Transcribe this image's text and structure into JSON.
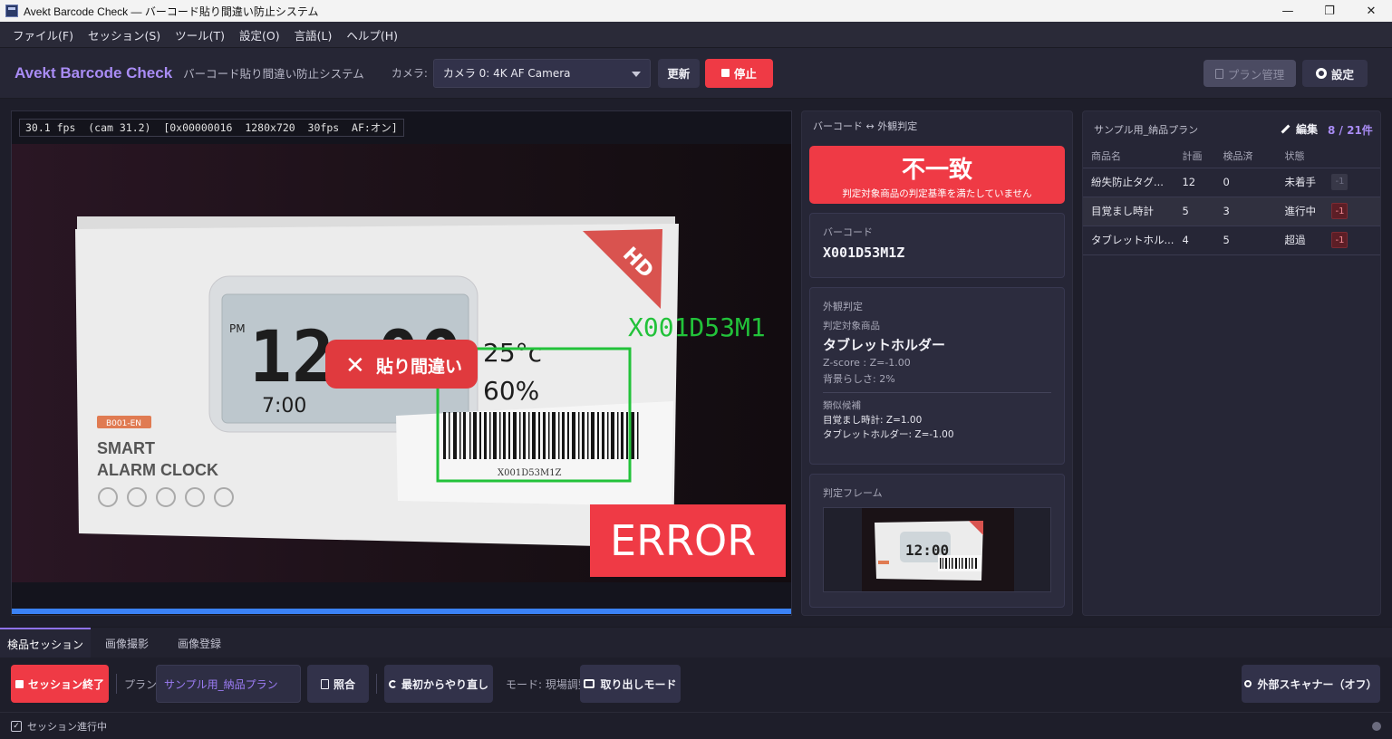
{
  "window": {
    "title": "Avekt Barcode Check — バーコード貼り間違い防止システム",
    "controls": [
      "—",
      "❐",
      "✕"
    ]
  },
  "menu": [
    "ファイル(F)",
    "セッション(S)",
    "ツール(T)",
    "設定(O)",
    "言語(L)",
    "ヘルプ(H)"
  ],
  "header": {
    "brand": "Avekt Barcode Check",
    "subtitle": "バーコード貼り間違い防止システム",
    "camera_label": "カメラ:",
    "camera_value": "カメラ 0:  4K AF Camera",
    "refresh_label": "更新",
    "stop_label": "停止",
    "plan_manage_label": "プラン管理",
    "settings_label": "設定"
  },
  "camera": {
    "status_line": "30.1 fps  (cam 31.2)  [0x00000016  1280x720  30fps  AF:オン]",
    "overlay_barcode": "X001D53M1",
    "overlay_mismatch": "貼り間違い",
    "overlay_error": "ERROR",
    "box_top_text": [
      "PM",
      "12:00",
      "25°c",
      "60%",
      "7:00"
    ],
    "box_label_code": "B001-EN",
    "box_title": [
      "SMART",
      "ALARM CLOCK"
    ],
    "barcode_print": "X001D53M1Z",
    "hd_text": "HD"
  },
  "verdict": {
    "panel_title": "バーコード ↔ 外観判定",
    "result": "不一致",
    "result_sub": "判定対象商品の判定基準を満たしていません",
    "barcode_label": "バーコード",
    "barcode_value": "X001D53M1Z",
    "appearance_label": "外観判定",
    "target_label": "判定対象商品",
    "target_product": "タブレットホルダー",
    "zscore": "Z-score : Z=-1.00",
    "background": "背景らしさ: 2%",
    "similar_label": "類似候補",
    "similar": [
      "目覚まし時計: Z=1.00",
      "タブレットホルダー: Z=-1.00"
    ],
    "frame_label": "判定フレーム"
  },
  "plan": {
    "title": "サンプル用_納品プラン",
    "edit_label": "編集",
    "count": "8 / 21件",
    "columns": [
      "商品名",
      "計画",
      "検品済",
      "状態"
    ],
    "rows": [
      {
        "name": "紛失防止タグ...",
        "plan": "12",
        "done": "0",
        "status": "未着手",
        "dec": "-1"
      },
      {
        "name": "目覚まし時計",
        "plan": "5",
        "done": "3",
        "status": "進行中",
        "dec": "-1"
      },
      {
        "name": "タブレットホル...",
        "plan": "4",
        "done": "5",
        "status": "超過",
        "dec": "-1"
      }
    ]
  },
  "tabs": [
    "検品セッション",
    "画像撮影",
    "画像登録"
  ],
  "toolbar": {
    "end_session": "セッション終了",
    "plan_label": "プラン:",
    "plan_value": "サンプル用_納品プラン",
    "match_label": "照合",
    "restart_label": "最初からやり直し",
    "mode_label": "モード: 現場調整",
    "takeout_label": "取り出しモード",
    "scanner_label": "外部スキャナー（オフ）"
  },
  "status": {
    "text": "セッション進行中",
    "check": "✓"
  },
  "colors": {
    "accent": "#a98cf5",
    "danger": "#ef3a45",
    "progress_blue": "#3b82f6",
    "overlay_green": "#22c23a"
  }
}
